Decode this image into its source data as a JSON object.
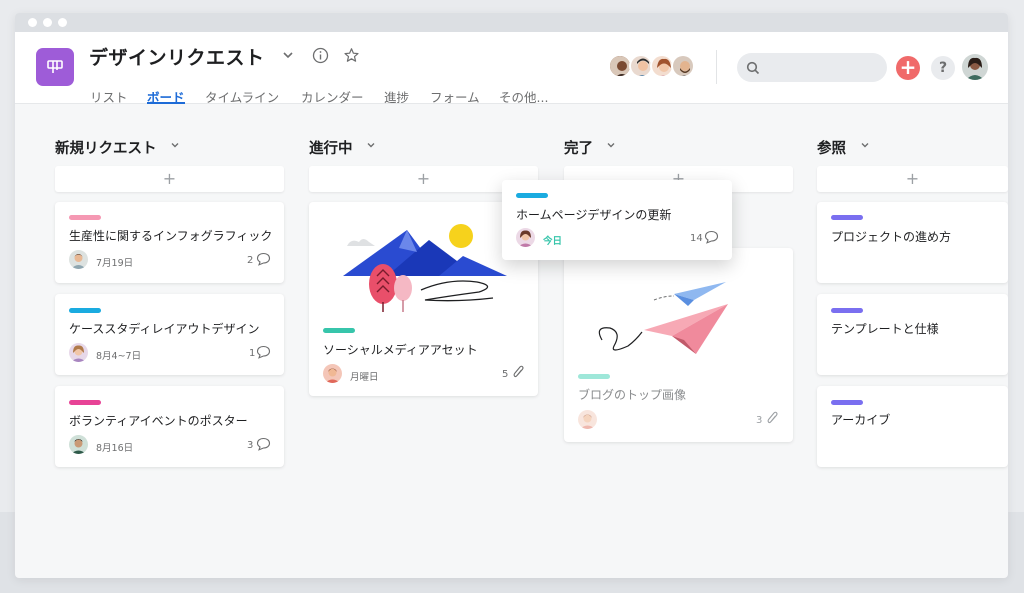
{
  "project": {
    "title": "デザインリクエスト"
  },
  "tabs": [
    {
      "label": "リスト"
    },
    {
      "label": "ボード"
    },
    {
      "label": "タイムライン"
    },
    {
      "label": "カレンダー"
    },
    {
      "label": "進捗"
    },
    {
      "label": "フォーム"
    },
    {
      "label": "その他..."
    }
  ],
  "search": {
    "placeholder": ""
  },
  "header_buttons": {
    "add": "+",
    "help": "?"
  },
  "columns": [
    {
      "title": "新規リクエスト",
      "add": "+",
      "cards": [
        {
          "title": "生産性に関するインフォグラフィック",
          "date": "7月19日",
          "count": "2",
          "tag_color": "#f598b3",
          "meta_icon": "comment-icon"
        },
        {
          "title": "ケーススタディレイアウトデザイン",
          "date": "8月4~7日",
          "count": "1",
          "tag_color": "#1aabe0",
          "meta_icon": "comment-icon"
        },
        {
          "title": "ボランティアイベントのポスター",
          "date": "8月16日",
          "count": "3",
          "tag_color": "#e74396",
          "meta_icon": "comment-icon"
        }
      ]
    },
    {
      "title": "進行中",
      "add": "+",
      "cards": [
        {
          "title": "ソーシャルメディアアセット",
          "date": "月曜日",
          "count": "5",
          "tag_color": "#37c5ab",
          "meta_icon": "attachment-icon"
        }
      ]
    },
    {
      "title": "完了",
      "add": "+",
      "cards": [
        {
          "title": "ブログのトップ画像",
          "date": "",
          "count": "3",
          "tag_color": "#9ee7d9",
          "meta_icon": "attachment-icon"
        }
      ]
    },
    {
      "title": "参照",
      "add": "+",
      "cards": [
        {
          "title": "プロジェクトの進め方",
          "tag_color": "#7a6ff0"
        },
        {
          "title": "テンプレートと仕様",
          "tag_color": "#7a6ff0"
        },
        {
          "title": "アーカイブ",
          "tag_color": "#7a6ff0"
        }
      ]
    }
  ],
  "dragging_card": {
    "title": "ホームページデザインの更新",
    "date": "今日",
    "count": "14",
    "tag_color": "#1aabe0",
    "meta_icon": "comment-icon"
  }
}
